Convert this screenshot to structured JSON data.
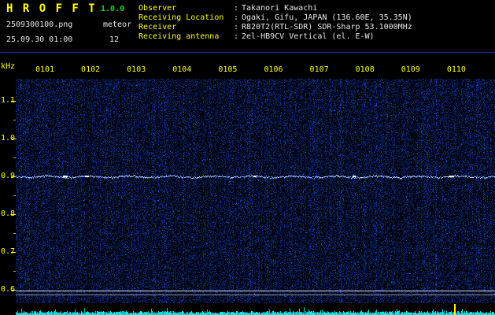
{
  "header": {
    "title": "H R O F F T",
    "version": "1.0.0",
    "filename": "2509300100.png",
    "mode": "meteor",
    "datetime": "25.09.30 01:00",
    "meteor_count": "12"
  },
  "info": {
    "separator": ":",
    "rows": [
      {
        "label": "Observer",
        "value": "Takanori Kawachi"
      },
      {
        "label": "Receiving Location",
        "value": "Ogaki, Gifu, JAPAN (136.60E, 35.35N)"
      },
      {
        "label": "Receiver",
        "value": "R820T2(RTL-SDR) SDR-Sharp 53.1000MHz"
      },
      {
        "label": "Receiving antenna",
        "value": "2el-HB9CV Vertical (el. E-W)"
      }
    ]
  },
  "chart_data": {
    "type": "heatmap",
    "title": "HROFFT radio meteor echo spectrogram, 25.09.30 01:00, 10-minute window",
    "x": {
      "tick_labels": [
        "0101",
        "0102",
        "0103",
        "0104",
        "0105",
        "0106",
        "0107",
        "0108",
        "0109",
        "0110"
      ],
      "unit": "HHMM",
      "range_minutes": 10
    },
    "y_unit": "kHz",
    "y_tick_labels": [
      "1.1",
      "1.0",
      "0.9",
      "0.8",
      "0.7",
      "0.6"
    ],
    "ylim": [
      0.56,
      1.16
    ],
    "content": {
      "carrier_line_khz": 0.9,
      "carrier_line_appearance": "continuous wavy white-cyan horizontal trace across all 10 minutes",
      "reference_lines_khz": [
        0.61,
        0.6
      ],
      "meteor_echo_count": 12,
      "background": "dark blue random noise speckle on black",
      "amplitude_strip": "cyan per-second signal-strength bars along bottom edge with one tall yellow event spike near 0109.6"
    },
    "grid": false,
    "legend": "none",
    "colors": {
      "background": "#000000",
      "noise_blue": "#0010a0",
      "carrier_line": "#eaf8ff",
      "axis_text": "#ffff00",
      "header_label": "#ffff00",
      "header_value": "#e8e8e8",
      "version_text": "#00dd00",
      "amplitude_bars": "#00ffff",
      "event_spike": "#ffff00",
      "divider": "#2233bb"
    }
  }
}
